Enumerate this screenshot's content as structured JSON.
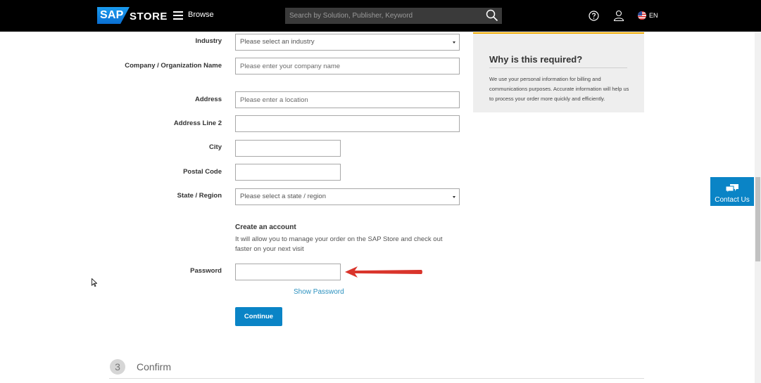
{
  "header": {
    "logo_text": "SAP",
    "store_label": "STORE",
    "browse_label": "Browse",
    "search_placeholder": "Search by Solution, Publisher, Keyword",
    "language": "EN"
  },
  "form": {
    "industry": {
      "label": "Industry",
      "value": "Please select an industry"
    },
    "company": {
      "label": "Company / Organization Name",
      "placeholder": "Please enter your company name"
    },
    "address": {
      "label": "Address",
      "placeholder": "Please enter a location"
    },
    "address2": {
      "label": "Address Line 2",
      "placeholder": ""
    },
    "city": {
      "label": "City",
      "placeholder": ""
    },
    "postal": {
      "label": "Postal Code",
      "placeholder": ""
    },
    "state": {
      "label": "State / Region",
      "value": "Please select a state / region"
    },
    "account": {
      "title": "Create an account",
      "description": "It will allow you to manage your order on the SAP Store and check out faster on your next visit"
    },
    "password": {
      "label": "Password",
      "placeholder": ""
    },
    "show_password": "Show Password",
    "continue_label": "Continue"
  },
  "info_panel": {
    "title": "Why is this required?",
    "text": "We use your personal information for billing and communications purposes. Accurate information will help us to process your order more quickly and efficiently."
  },
  "contact": {
    "label": "Contact Us"
  },
  "step3": {
    "number": "3",
    "label": "Confirm"
  },
  "colors": {
    "header_bg": "#000000",
    "accent_blue": "#0a84c6",
    "link_blue": "#2b91bf",
    "panel_border": "#f0ab00",
    "arrow_red": "#d9342b"
  },
  "icons": {
    "menu": "hamburger-icon",
    "search": "search-icon",
    "help": "question-circle-icon",
    "user": "user-icon",
    "flag": "us-flag-icon",
    "contact": "chat-bubbles-icon",
    "annotation": "red-arrow-icon"
  }
}
